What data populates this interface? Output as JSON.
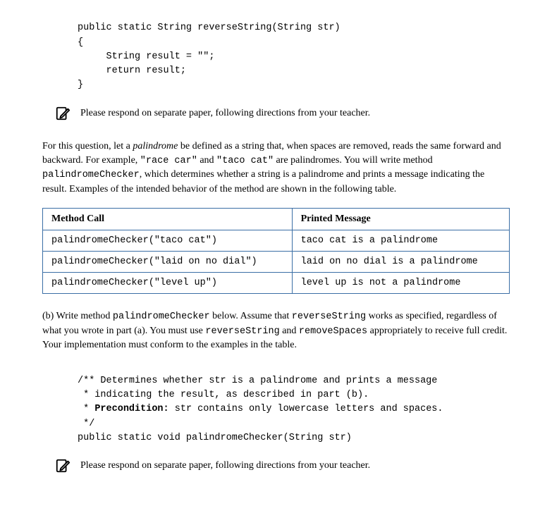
{
  "code_top": {
    "line1": "public static String reverseString(String str)",
    "line2": "{",
    "line3": "     String result = \"\";",
    "line4": "     return result;",
    "line5": "}"
  },
  "respond_message": "Please respond on separate paper, following directions from your teacher.",
  "intro": {
    "part1": "For this question, let a ",
    "palindrome_word": "palindrome",
    "part2": " be defined as a string that, when spaces are removed, reads the same forward and backward. For example, ",
    "example1": "\"race car\"",
    "part3": " and ",
    "example2": "\"taco cat\"",
    "part4": " are palindromes. You will write method ",
    "method_name": "palindromeChecker",
    "part5": ", which determines whether a string is a palindrome and prints a message indicating the result. Examples of the intended behavior of the method are shown in the following table."
  },
  "table": {
    "header_call": "Method Call",
    "header_msg": "Printed Message",
    "rows": [
      {
        "call": "palindromeChecker(\"taco cat\")",
        "msg": "taco cat is a palindrome"
      },
      {
        "call": "palindromeChecker(\"laid on no dial\")",
        "msg": "laid on no dial is a palindrome"
      },
      {
        "call": "palindromeChecker(\"level up\")",
        "msg": "level up is not a palindrome"
      }
    ]
  },
  "part_b": {
    "label": "(b)",
    "pre1": "   Write method ",
    "m1": "palindromeChecker",
    "post1": " below. Assume that ",
    "m2": "reverseString",
    "post2": " works as specified, regardless of what you wrote in part (a). You must use ",
    "m3": "reverseString",
    "post3": " and ",
    "m4": "removeSpaces",
    "post4": " appropriately to receive full credit. Your implementation must conform to the examples in the table."
  },
  "code_bottom": {
    "line1": "/** Determines whether str is a palindrome and prints a message",
    "line2": " * indicating the result, as described in part (b).",
    "line3_pre": " * ",
    "line3_bold": "Precondition:",
    "line3_post": " str contains only lowercase letters and spaces.",
    "line4": " */",
    "line5": "public static void palindromeChecker(String str)"
  }
}
